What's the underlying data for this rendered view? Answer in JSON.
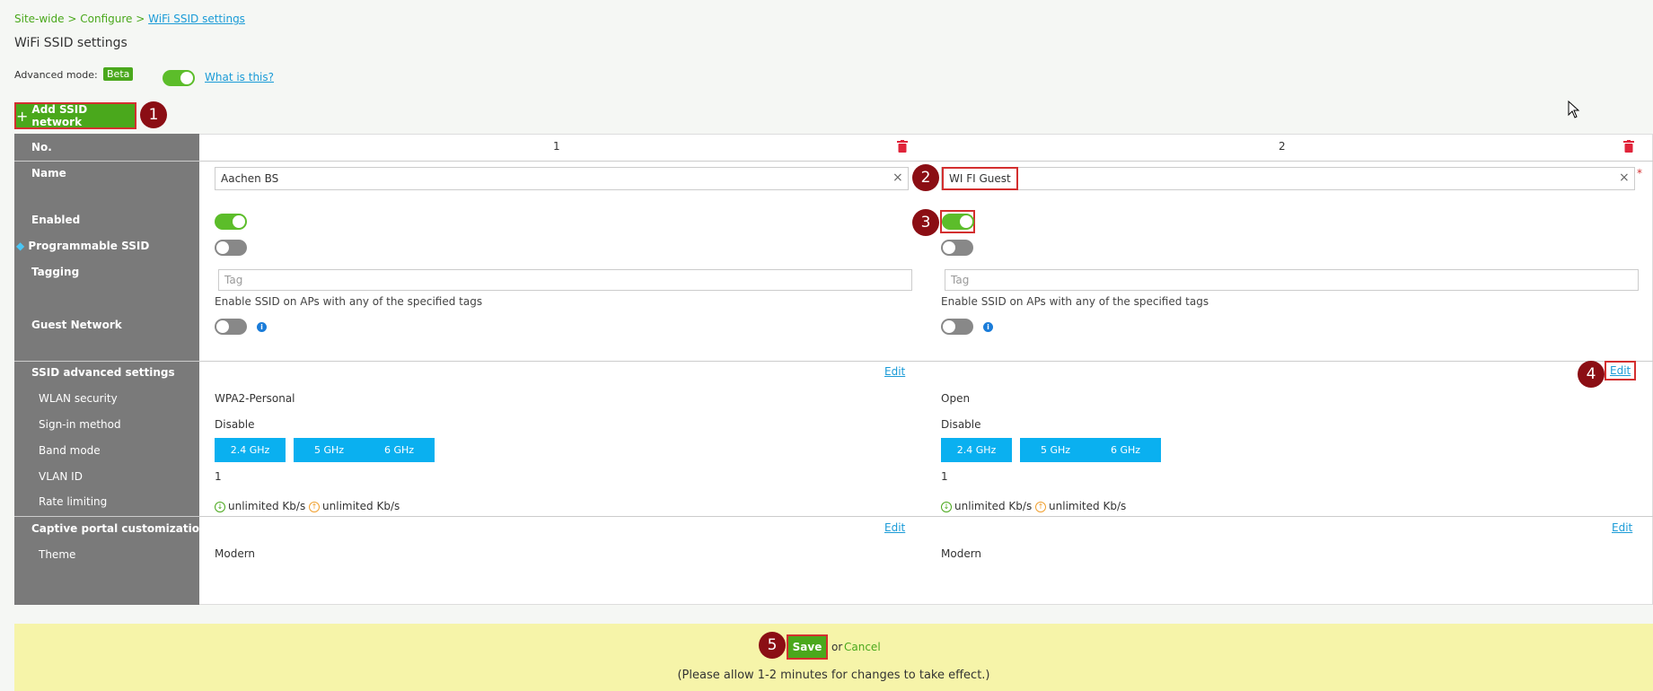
{
  "breadcrumb": {
    "site": "Site-wide",
    "configure": "Configure",
    "current": "WiFi SSID settings",
    "sep": ">"
  },
  "page_title": "WiFi SSID settings",
  "advanced_mode": {
    "label": "Advanced mode:",
    "badge": "Beta",
    "enabled": true,
    "help_link": "What is this?"
  },
  "add_button": {
    "label": "Add SSID network"
  },
  "step_badges": [
    "1",
    "2",
    "3",
    "4",
    "5"
  ],
  "rows": {
    "no": "No.",
    "name": "Name",
    "enabled": "Enabled",
    "programmable": "Programmable SSID",
    "tagging": "Tagging",
    "guest": "Guest Network",
    "ssid_adv": "SSID advanced settings",
    "wlan_security": "WLAN security",
    "sign_in": "Sign-in method",
    "band_mode": "Band mode",
    "vlan_id": "VLAN ID",
    "rate_limiting": "Rate limiting",
    "captive": "Captive portal customization",
    "theme": "Theme"
  },
  "columns": [
    {
      "no": "1",
      "name": "Aachen BS",
      "enabled": true,
      "programmable": false,
      "tag_placeholder": "Tag",
      "tag_helper": "Enable SSID on APs with any of the specified tags",
      "guest": false,
      "edit_label": "Edit",
      "wlan_security": "WPA2-Personal",
      "sign_in": "Disable",
      "bands": [
        "2.4 GHz",
        "5 GHz",
        "6 GHz"
      ],
      "vlan_id": "1",
      "rate_down": "unlimited Kb/s",
      "rate_up": "unlimited Kb/s",
      "captive_edit": "Edit",
      "theme": "Modern"
    },
    {
      "no": "2",
      "name": "WI FI Guest",
      "enabled": true,
      "programmable": false,
      "tag_placeholder": "Tag",
      "tag_helper": "Enable SSID on APs with any of the specified tags",
      "guest": false,
      "edit_label": "Edit",
      "wlan_security": "Open",
      "sign_in": "Disable",
      "bands": [
        "2.4 GHz",
        "5 GHz",
        "6 GHz"
      ],
      "vlan_id": "1",
      "rate_down": "unlimited Kb/s",
      "rate_up": "unlimited Kb/s",
      "captive_edit": "Edit",
      "theme": "Modern"
    }
  ],
  "required_mark": "*",
  "clear_glyph": "×",
  "info_glyph": "i",
  "footer": {
    "save": "Save",
    "or": "or",
    "cancel": "Cancel",
    "note": "(Please allow 1-2 minutes for changes to take effect.)"
  },
  "colors": {
    "accent_green": "#4aa81c",
    "link_blue": "#1a9bd7",
    "band_blue": "#0ab0f0",
    "badge_red": "#8b0e14",
    "footer_yellow": "#f6f4a9"
  }
}
